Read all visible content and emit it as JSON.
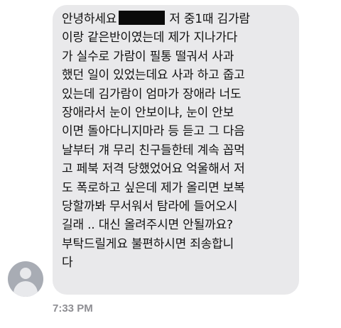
{
  "message": {
    "lines": [
      {
        "before": "안녕하세요",
        "redacted": true,
        "after": "저 중1때 김가람"
      },
      {
        "text": "이랑 같은반이였는데 제가 지나가다"
      },
      {
        "text": "가 실수로 가람이 필통 떨궈서 사과"
      },
      {
        "text": "했던 일이 있었는데요 사과 하고 줍고"
      },
      {
        "text": "있는데 김가람이 엄마가 장애라 너도"
      },
      {
        "text": "장애라서 눈이 안보이냐, 눈이 안보"
      },
      {
        "text": "이면 돌아다니지마라 등 듣고 그 다음"
      },
      {
        "text": "날부터 걔 무리 친구들한테 계속 꼽먹"
      },
      {
        "text": "고 페북 저격 당했었어요 억울해서 저"
      },
      {
        "text": "도 폭로하고 싶은데 제가 올리면 보복"
      },
      {
        "text": "당할까봐 무서워서 탐라에 들어오시"
      },
      {
        "text": "길래 .. 대신 올려주시면 안될까요?"
      },
      {
        "text": "부탁드릴게요 불편하시면 죄송합니"
      },
      {
        "text": "다"
      }
    ]
  },
  "sender": {
    "avatar_icon": "default-user-icon"
  },
  "timestamp": "7:33 PM",
  "colors": {
    "bubble": "#e9e9eb",
    "timestamp": "#8e8e93",
    "avatar": "#a8acb4"
  }
}
